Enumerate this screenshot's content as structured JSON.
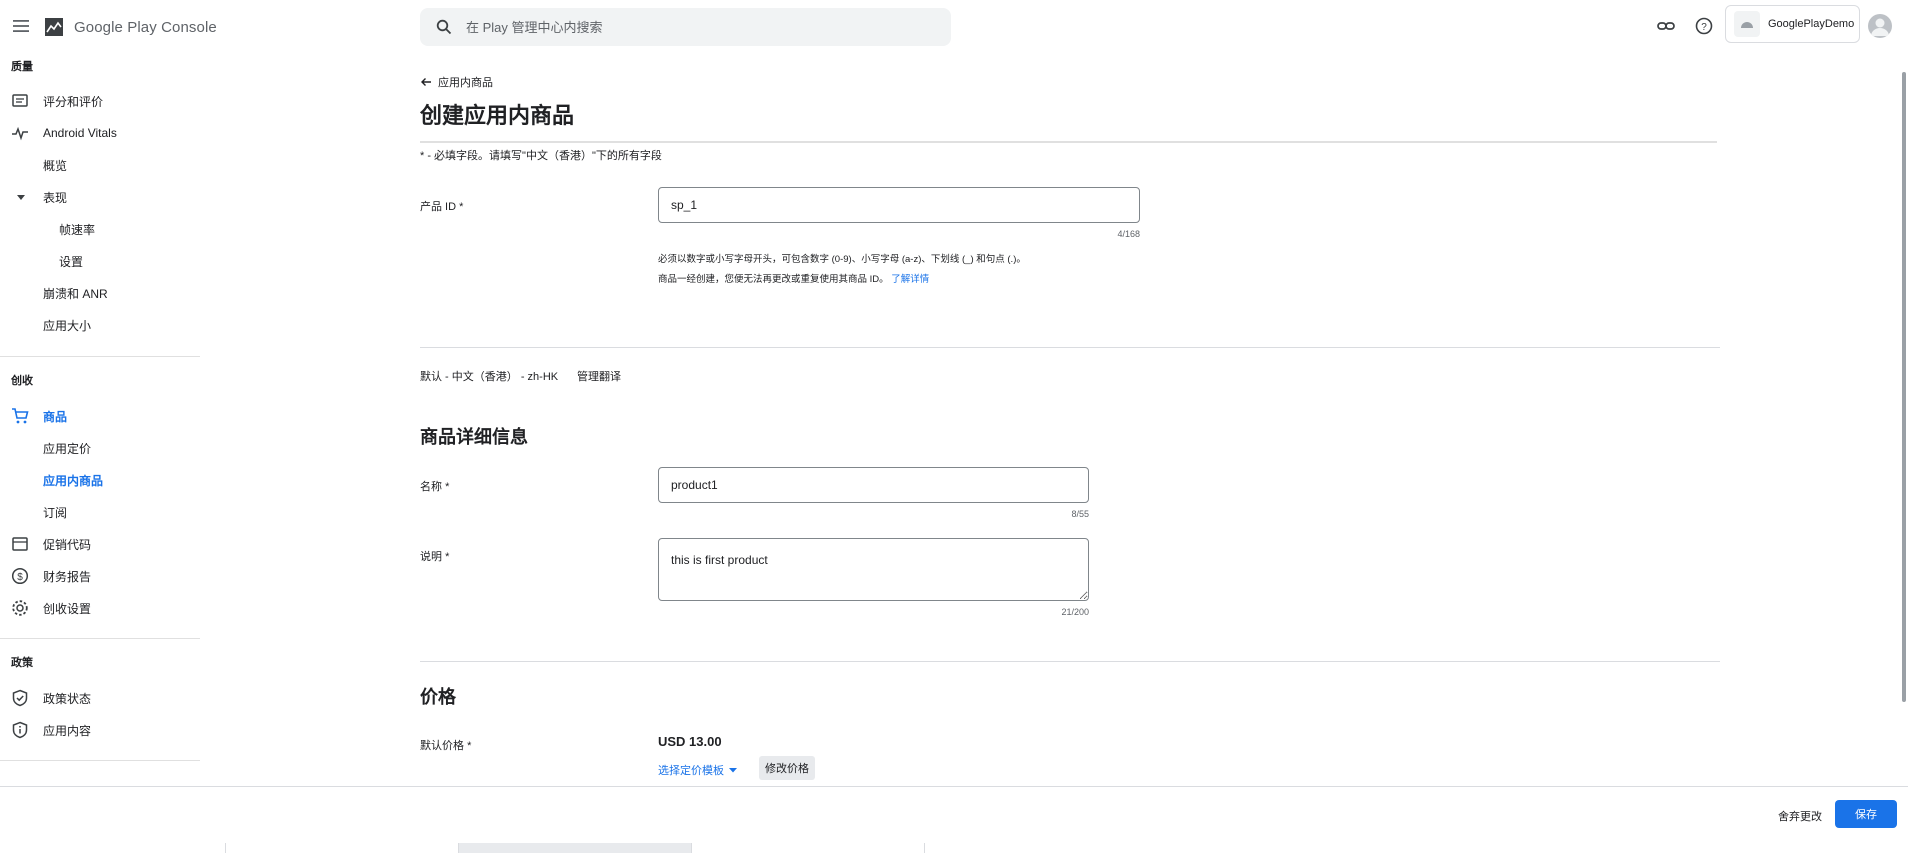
{
  "header": {
    "logo_text": "Google Play",
    "logo_console": "Console",
    "search_placeholder": "在 Play 管理中心内搜索",
    "account_name": "GooglePlayDemo"
  },
  "sidebar": {
    "sections": [
      {
        "title": "质量"
      },
      {
        "title": "创收"
      },
      {
        "title": "政策"
      }
    ],
    "items": [
      {
        "label": "评分和评价",
        "icon": "rating-icon"
      },
      {
        "label": "Android Vitals",
        "icon": "vitals-icon"
      },
      {
        "label": "概览"
      },
      {
        "label": "表现"
      },
      {
        "label": "帧速率"
      },
      {
        "label": "设置"
      },
      {
        "label": "崩溃和 ANR"
      },
      {
        "label": "应用大小"
      },
      {
        "label": "商品",
        "icon": "cart-icon"
      },
      {
        "label": "应用定价"
      },
      {
        "label": "应用内商品"
      },
      {
        "label": "订阅"
      },
      {
        "label": "促销代码",
        "icon": "promo-icon"
      },
      {
        "label": "财务报告",
        "icon": "dollar-icon"
      },
      {
        "label": "创收设置",
        "icon": "gear-icon"
      },
      {
        "label": "政策状态",
        "icon": "shield-check-icon"
      },
      {
        "label": "应用内容",
        "icon": "shield-info-icon"
      }
    ]
  },
  "main": {
    "back_label": "应用内商品",
    "title": "创建应用内商品",
    "required_note": "* - 必填字段。请填写\"中文（香港）\"下的所有字段",
    "product_id": {
      "label": "产品 ID",
      "required_mark": "*",
      "value": "sp_1",
      "counter": "4/168",
      "help_line1": "必须以数字或小写字母开头，可包含数字 (0-9)、小写字母 (a-z)、下划线 (_) 和句点 (.)。",
      "help_line2": "商品一经创建，您便无法再更改或重复使用其商品 ID。",
      "learn_more": "了解详情"
    },
    "language": {
      "default": "默认 - 中文（香港） - zh-HK",
      "manage": "管理翻译"
    },
    "details": {
      "title": "商品详细信息",
      "name_label": "名称",
      "name_value": "product1",
      "name_counter": "8/55",
      "desc_label": "说明",
      "desc_value": "this is first product",
      "desc_counter": "21/200",
      "required_mark": "*"
    },
    "price": {
      "title": "价格",
      "label": "默认价格",
      "required_mark": "*",
      "value": "USD 13.00",
      "template_label": "选择定价模板",
      "edit_label": "修改价格"
    }
  },
  "footer": {
    "discard_label": "舍弃更改",
    "save_label": "保存"
  },
  "colors": {
    "accent": "#1a73e8",
    "text": "#202124",
    "muted": "#5f6368",
    "divider": "#dadce0"
  }
}
